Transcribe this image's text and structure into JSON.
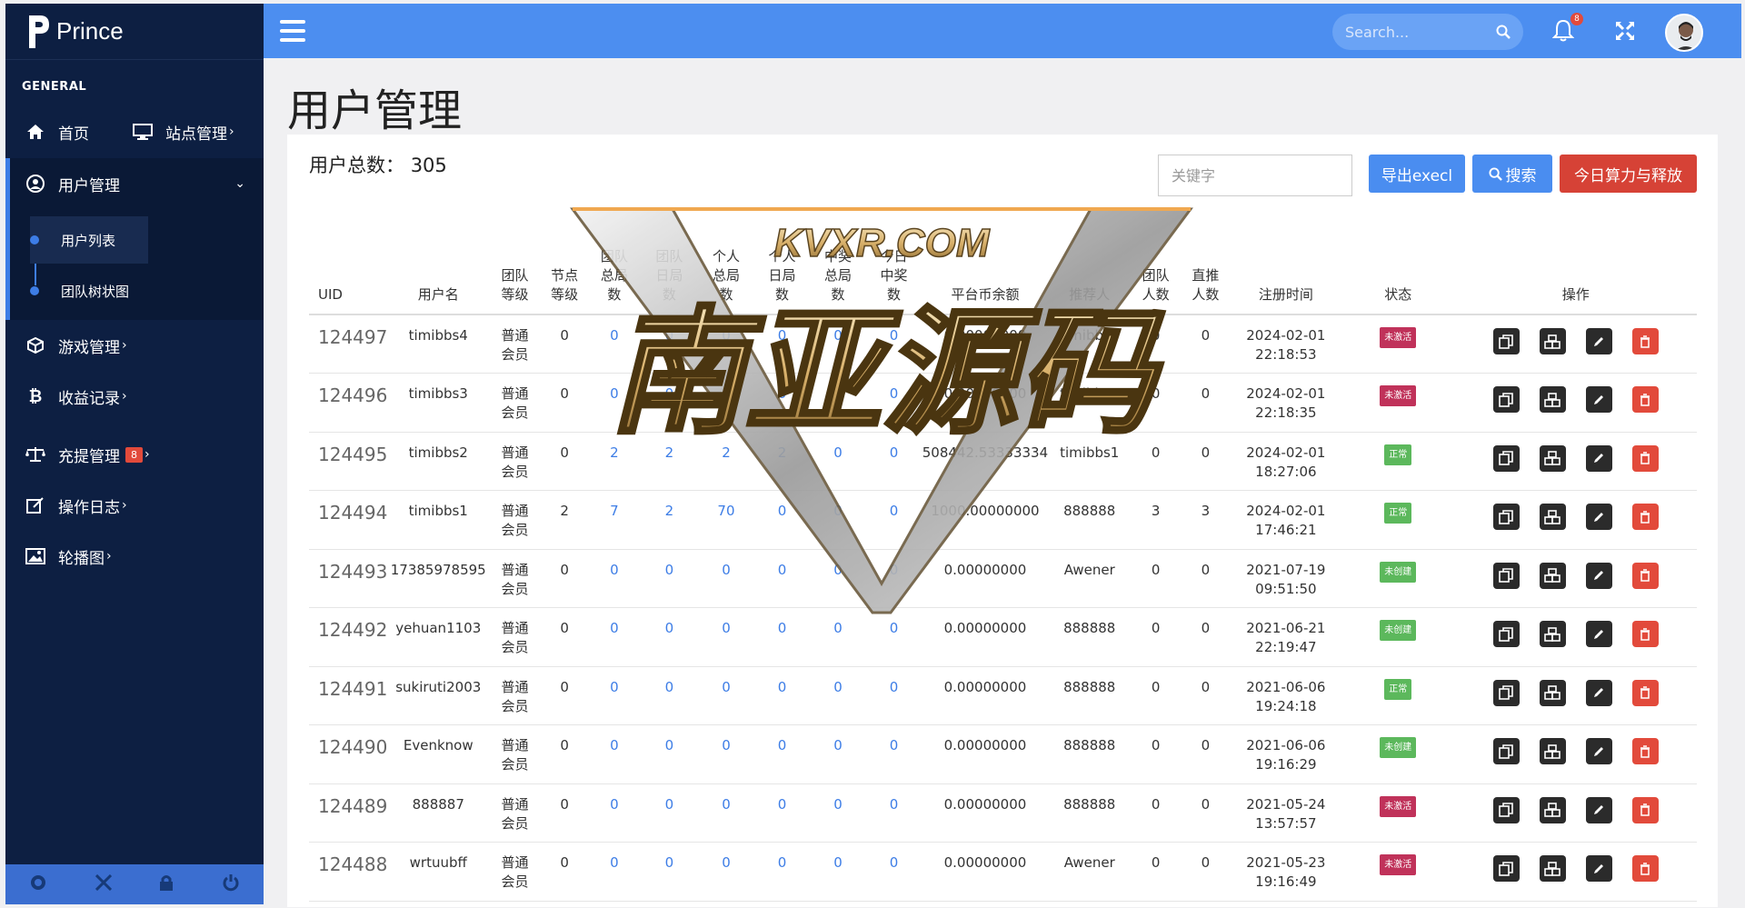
{
  "brand": {
    "name": "Prince"
  },
  "sidebar": {
    "section": "GENERAL",
    "home": "首页",
    "site_manage": "站点管理",
    "user_manage": "用户管理",
    "user_list": "用户列表",
    "team_tree": "团队树状图",
    "game_manage": "游戏管理",
    "income_log": "收益记录",
    "withdraw_manage": "充提管理",
    "withdraw_badge": "8",
    "op_log": "操作日志",
    "carousel": "轮播图"
  },
  "topbar": {
    "search_placeholder": "Search...",
    "bell_count": "8"
  },
  "page": {
    "title": "用户管理",
    "total_label": "用户总数：",
    "total_value": "305"
  },
  "toolbar": {
    "keyword_placeholder": "关键字",
    "export_label": "导出execl",
    "search_label": "搜索",
    "today_label": "今日算力与释放"
  },
  "table": {
    "headers": [
      "UID",
      "用户名",
      "团队\n等级",
      "节点\n等级",
      "团队\n总局\n数",
      "团队\n日局\n数",
      "个人\n总局\n数",
      "个人\n日局\n数",
      "中奖\n总局\n数",
      "今日\n中奖\n数",
      "平台币余额",
      "推荐人",
      "团队\n人数",
      "直推\n人数",
      "注册时间",
      "状态",
      "操作"
    ],
    "rows": [
      {
        "uid": "124497",
        "name": "timibbs4",
        "level": "普通\n会员",
        "node": "0",
        "t_total": "0",
        "t_day": "0",
        "p_total": "0",
        "p_day": "0",
        "w_total": "0",
        "w_today": "0",
        "balance": "0.00000000",
        "ref": "timibbs1",
        "team": "0",
        "direct": "0",
        "date": "2024-02-01",
        "time": "22:18:53",
        "status": "未激活",
        "status_color": "#c0325a"
      },
      {
        "uid": "124496",
        "name": "timibbs3",
        "level": "普通\n会员",
        "node": "0",
        "t_total": "0",
        "t_day": "0",
        "p_total": "0",
        "p_day": "0",
        "w_total": "0",
        "w_today": "0",
        "balance": "0.00000000",
        "ref": "timibbs1",
        "team": "0",
        "direct": "0",
        "date": "2024-02-01",
        "time": "22:18:35",
        "status": "未激活",
        "status_color": "#c0325a"
      },
      {
        "uid": "124495",
        "name": "timibbs2",
        "level": "普通\n会员",
        "node": "0",
        "t_total": "2",
        "t_day": "2",
        "p_total": "2",
        "p_day": "2",
        "w_total": "0",
        "w_today": "0",
        "balance": "508442.53333334",
        "ref": "timibbs1",
        "team": "0",
        "direct": "0",
        "date": "2024-02-01",
        "time": "18:27:06",
        "status": "正常",
        "status_color": "#5cb85c"
      },
      {
        "uid": "124494",
        "name": "timibbs1",
        "level": "普通\n会员",
        "node": "2",
        "t_total": "7",
        "t_day": "2",
        "p_total": "70",
        "p_day": "0",
        "w_total": "0",
        "w_today": "0",
        "balance": "1000.00000000",
        "ref": "888888",
        "team": "3",
        "direct": "3",
        "date": "2024-02-01",
        "time": "17:46:21",
        "status": "正常",
        "status_color": "#5cb85c"
      },
      {
        "uid": "124493",
        "name": "17385978595",
        "level": "普通\n会员",
        "node": "0",
        "t_total": "0",
        "t_day": "0",
        "p_total": "0",
        "p_day": "0",
        "w_total": "0",
        "w_today": "0",
        "balance": "0.00000000",
        "ref": "Awener",
        "team": "0",
        "direct": "0",
        "date": "2021-07-19",
        "time": "09:51:50",
        "status": "未创建",
        "status_color": "#5cb85c"
      },
      {
        "uid": "124492",
        "name": "yehuan1103",
        "level": "普通\n会员",
        "node": "0",
        "t_total": "0",
        "t_day": "0",
        "p_total": "0",
        "p_day": "0",
        "w_total": "0",
        "w_today": "0",
        "balance": "0.00000000",
        "ref": "888888",
        "team": "0",
        "direct": "0",
        "date": "2021-06-21",
        "time": "22:19:47",
        "status": "未创建",
        "status_color": "#5cb85c"
      },
      {
        "uid": "124491",
        "name": "sukiruti2003",
        "level": "普通\n会员",
        "node": "0",
        "t_total": "0",
        "t_day": "0",
        "p_total": "0",
        "p_day": "0",
        "w_total": "0",
        "w_today": "0",
        "balance": "0.00000000",
        "ref": "888888",
        "team": "0",
        "direct": "0",
        "date": "2021-06-06",
        "time": "19:24:18",
        "status": "正常",
        "status_color": "#5cb85c"
      },
      {
        "uid": "124490",
        "name": "Evenknow",
        "level": "普通\n会员",
        "node": "0",
        "t_total": "0",
        "t_day": "0",
        "p_total": "0",
        "p_day": "0",
        "w_total": "0",
        "w_today": "0",
        "balance": "0.00000000",
        "ref": "888888",
        "team": "0",
        "direct": "0",
        "date": "2021-06-06",
        "time": "19:16:29",
        "status": "未创建",
        "status_color": "#5cb85c"
      },
      {
        "uid": "124489",
        "name": "888887",
        "level": "普通\n会员",
        "node": "0",
        "t_total": "0",
        "t_day": "0",
        "p_total": "0",
        "p_day": "0",
        "w_total": "0",
        "w_today": "0",
        "balance": "0.00000000",
        "ref": "888888",
        "team": "0",
        "direct": "0",
        "date": "2021-05-24",
        "time": "13:57:57",
        "status": "未激活",
        "status_color": "#c0325a"
      },
      {
        "uid": "124488",
        "name": "wrtuubff",
        "level": "普通\n会员",
        "node": "0",
        "t_total": "0",
        "t_day": "0",
        "p_total": "0",
        "p_day": "0",
        "w_total": "0",
        "w_today": "0",
        "balance": "0.00000000",
        "ref": "Awener",
        "team": "0",
        "direct": "0",
        "date": "2021-05-23",
        "time": "19:16:49",
        "status": "未激活",
        "status_color": "#c0325a"
      }
    ]
  },
  "watermark": {
    "top_text": "KVXR.COM",
    "main_text": "南亚源码"
  }
}
